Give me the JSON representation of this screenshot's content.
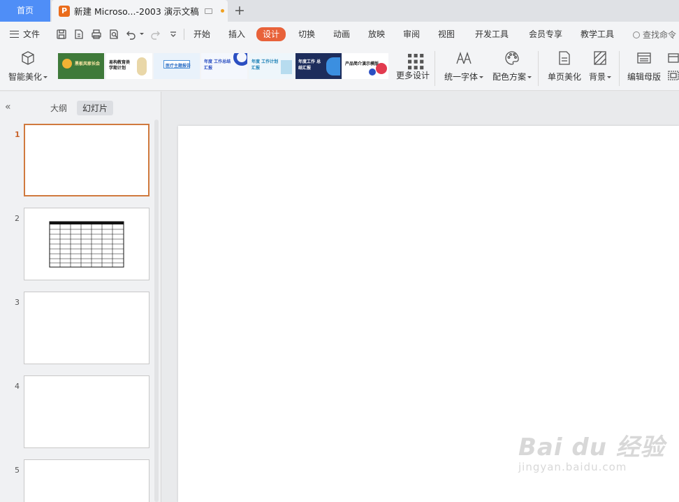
{
  "tabs": {
    "home": "首页",
    "doc_title": "新建 Microso...-2003 演示文稿",
    "add": "+"
  },
  "menu": {
    "file": "文件",
    "tabs": [
      "开始",
      "插入",
      "设计",
      "切换",
      "动画",
      "放映",
      "审阅",
      "视图",
      "开发工具",
      "会员专享",
      "教学工具"
    ],
    "active_tab": "设计",
    "search": "查找命令"
  },
  "ribbon": {
    "smart_beautify": "智能美化",
    "more_design": "更多设计",
    "unify_font": "统一字体",
    "color_scheme": "配色方案",
    "single_page": "单页美化",
    "background": "背景",
    "edit_master": "编辑母版",
    "templates": [
      {
        "text": "黑板风家长会",
        "bg": "#3f7a3a"
      },
      {
        "text": "易构教育类 学期计划",
        "bg": "#ffffff"
      },
      {
        "text": "医疗主题报告",
        "bg": "#e9f2fb"
      },
      {
        "text": "年度 工作总结汇报",
        "bg": "#f4f7fd"
      },
      {
        "text": "年度 工作计划汇报",
        "bg": "#eef6fb"
      },
      {
        "text": "年度工作 总结汇报",
        "bg": "#1d2d5c"
      },
      {
        "text": "产品简介演示模版",
        "bg": "#ffffff"
      }
    ]
  },
  "panel": {
    "collapse": "«",
    "outline_tab": "大纲",
    "slides_tab": "幻灯片",
    "slide_numbers": [
      "1",
      "2",
      "3",
      "4",
      "5"
    ]
  },
  "watermark": {
    "main": "Bai du 经验",
    "url": "jingyan.baidu.com"
  },
  "colors": {
    "accent": "#e8623a",
    "home_tab": "#4f8ef7",
    "selected_border": "#d07a3e"
  }
}
